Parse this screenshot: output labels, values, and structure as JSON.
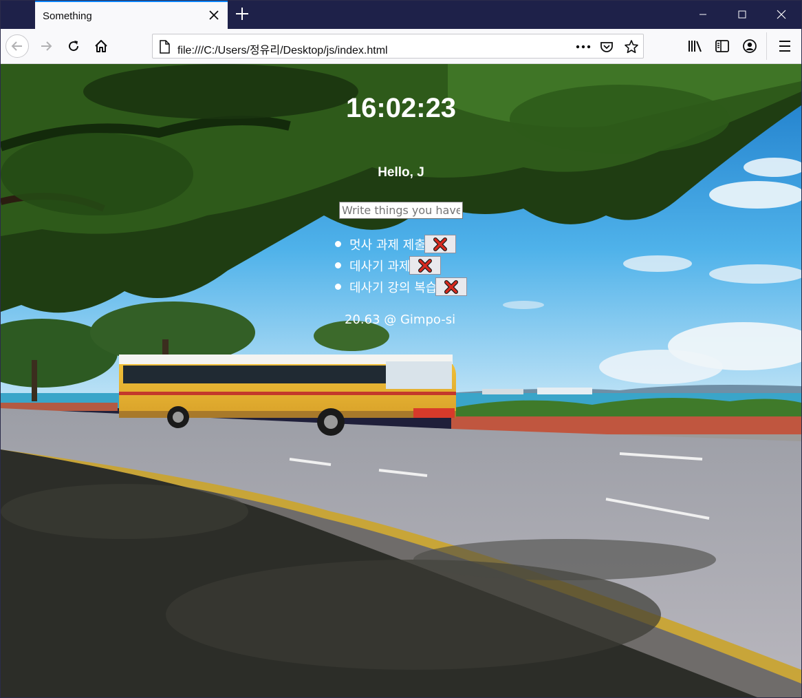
{
  "browser": {
    "tab": {
      "title": "Something",
      "close_icon": "close-icon"
    },
    "address_bar": {
      "url": "file:///C:/Users/정유리/Desktop/js/index.html"
    },
    "icons": [
      "back-arrow-icon",
      "forward-arrow-icon",
      "reload-icon",
      "home-icon",
      "page-icon",
      "more-actions-icon",
      "pocket-icon",
      "bookmark-star-icon",
      "library-icon",
      "sidebar-icon",
      "account-icon",
      "menu-icon"
    ],
    "accent_color": "#0a84ff"
  },
  "app": {
    "clock": "16:02:23",
    "greeting": "Hello, J",
    "todo_input": {
      "placeholder": "Write things you have to do",
      "value": ""
    },
    "todos": [
      {
        "text": "멋사 과제 제출",
        "delete_icon": "red-x-icon"
      },
      {
        "text": "데사기 과제",
        "delete_icon": "red-x-icon"
      },
      {
        "text": "데사기 강의 복습",
        "delete_icon": "red-x-icon"
      }
    ],
    "weather": "20.63 @ Gimpo-si",
    "background": "photo-yellow-bus-by-seaside-road"
  }
}
